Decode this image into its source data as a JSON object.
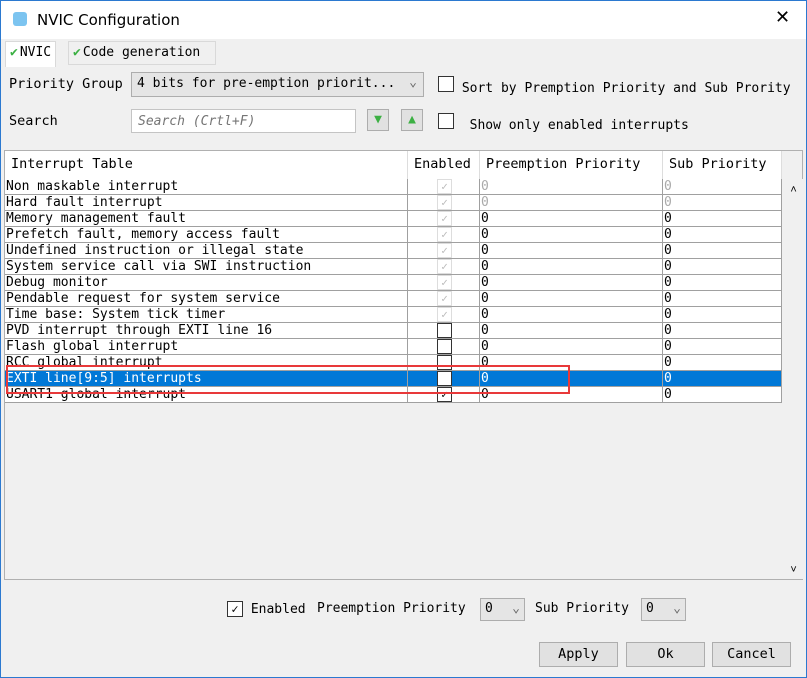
{
  "window": {
    "title": "NVIC Configuration",
    "close": "✕"
  },
  "tabs": [
    {
      "label": "NVIC"
    },
    {
      "label": "Code generation"
    }
  ],
  "priority_group": {
    "label": "Priority Group",
    "value": "4 bits for pre-emption priorit...",
    "sort_label": "Sort by Premption Priority and Sub Prority",
    "sort_checked": false
  },
  "search": {
    "label": "Search",
    "placeholder": "Search (Crtl+F)",
    "show_enabled_label": "Show only enabled interrupts",
    "show_enabled_checked": false
  },
  "table": {
    "headers": [
      "Interrupt Table",
      "Enabled",
      "Preemption Priority",
      "Sub Priority"
    ],
    "rows": [
      {
        "name": "Non maskable interrupt",
        "enabled": true,
        "locked": true,
        "pre": "0",
        "sub": "0",
        "gray": true
      },
      {
        "name": "Hard fault interrupt",
        "enabled": true,
        "locked": true,
        "pre": "0",
        "sub": "0",
        "gray": true
      },
      {
        "name": "Memory management fault",
        "enabled": true,
        "locked": true,
        "pre": "0",
        "sub": "0"
      },
      {
        "name": "Prefetch fault, memory access fault",
        "enabled": true,
        "locked": true,
        "pre": "0",
        "sub": "0"
      },
      {
        "name": "Undefined instruction or illegal state",
        "enabled": true,
        "locked": true,
        "pre": "0",
        "sub": "0"
      },
      {
        "name": "System service call via SWI instruction",
        "enabled": true,
        "locked": true,
        "pre": "0",
        "sub": "0"
      },
      {
        "name": "Debug monitor",
        "enabled": true,
        "locked": true,
        "pre": "0",
        "sub": "0"
      },
      {
        "name": "Pendable request for system service",
        "enabled": true,
        "locked": true,
        "pre": "0",
        "sub": "0"
      },
      {
        "name": "Time base: System tick timer",
        "enabled": true,
        "locked": true,
        "pre": "0",
        "sub": "0"
      },
      {
        "name": "PVD interrupt through EXTI line 16",
        "enabled": false,
        "pre": "0",
        "sub": "0"
      },
      {
        "name": "Flash global interrupt",
        "enabled": false,
        "pre": "0",
        "sub": "0"
      },
      {
        "name": "RCC global interrupt",
        "enabled": false,
        "pre": "0",
        "sub": "0"
      },
      {
        "name": "EXTI line[9:5] interrupts",
        "enabled": true,
        "pre": "0",
        "sub": "0",
        "selected": true
      },
      {
        "name": "USART1 global interrupt",
        "enabled": true,
        "pre": "0",
        "sub": "0"
      }
    ]
  },
  "footer": {
    "enabled_label": "Enabled",
    "enabled_checked": true,
    "pre_label": "Preemption Priority",
    "pre_value": "0",
    "sub_label": "Sub Priority",
    "sub_value": "0"
  },
  "buttons": {
    "apply": "Apply",
    "ok": "Ok",
    "cancel": "Cancel"
  },
  "colors": {
    "selection": "#0078d7",
    "highlight": "#e8393a"
  }
}
